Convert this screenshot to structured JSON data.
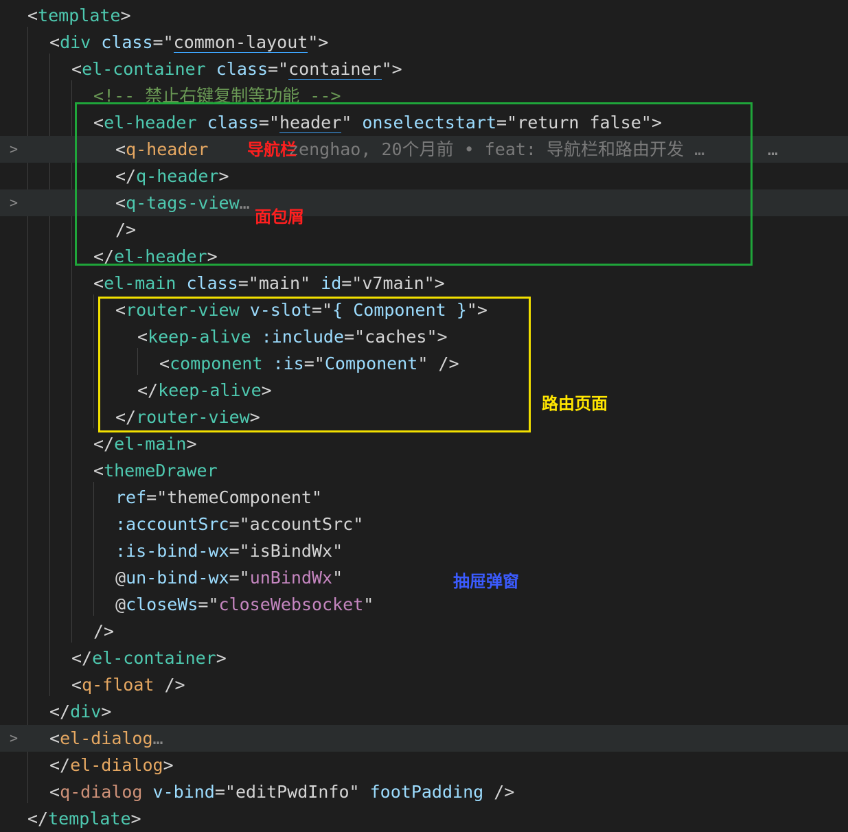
{
  "colors": {
    "background": "#1e1e1e",
    "highlight_line": "#2a2d2e",
    "tag": "#4ec9b0",
    "attribute": "#9cdcfe",
    "string": "#d4d4d4",
    "comment": "#6a9955",
    "box_header": "#1fa53a",
    "box_router": "#f2e000",
    "note_red": "#ff1f1f",
    "note_yellow": "#ffe600",
    "note_blue": "#3b5bff"
  },
  "icons": {
    "fold": "chevron-right-icon",
    "more": "ellipsis-icon"
  },
  "gutter": {
    "fold_glyph": ">"
  },
  "blame": {
    "text": "zenghao, 20个月前 • feat: 导航栏和路由开发 …",
    "more": "…"
  },
  "annotations": {
    "nav": "导航栏",
    "breadcrumb": "面包屑",
    "router_page": "路由页面",
    "drawer": "抽屉弹窗"
  },
  "lines": [
    [
      {
        "t": "<",
        "c": "punc"
      },
      {
        "t": "template",
        "c": "tag"
      },
      {
        "t": ">",
        "c": "punc"
      }
    ],
    [
      {
        "t": "<",
        "c": "punc"
      },
      {
        "t": "div",
        "c": "tag"
      },
      {
        "t": " class",
        "c": "attr"
      },
      {
        "t": "=\"",
        "c": "punc"
      },
      {
        "t": "common-layout",
        "c": "str-u"
      },
      {
        "t": "\">",
        "c": "punc"
      }
    ],
    [
      {
        "t": "<",
        "c": "punc"
      },
      {
        "t": "el-container",
        "c": "tag"
      },
      {
        "t": " class",
        "c": "attr"
      },
      {
        "t": "=\"",
        "c": "punc"
      },
      {
        "t": "container",
        "c": "str-u"
      },
      {
        "t": "\">",
        "c": "punc"
      }
    ],
    [
      {
        "t": "<!-- 禁止右键复制等功能 -->",
        "c": "comment"
      }
    ],
    [
      {
        "t": "<",
        "c": "punc"
      },
      {
        "t": "el-header",
        "c": "tag"
      },
      {
        "t": " class",
        "c": "attr"
      },
      {
        "t": "=\"",
        "c": "punc"
      },
      {
        "t": "header",
        "c": "str-u"
      },
      {
        "t": "\"",
        "c": "punc"
      },
      {
        "t": " onselectstart",
        "c": "attr"
      },
      {
        "t": "=\"return false\">",
        "c": "punc"
      }
    ],
    [
      {
        "t": "<",
        "c": "punc"
      },
      {
        "t": "q-header",
        "c": "tag3"
      }
    ],
    [
      {
        "t": "</",
        "c": "punc"
      },
      {
        "t": "q-header",
        "c": "tag"
      },
      {
        "t": ">",
        "c": "punc"
      }
    ],
    [
      {
        "t": "<",
        "c": "punc"
      },
      {
        "t": "q-tags-view",
        "c": "tag"
      },
      {
        "t": "…",
        "c": "fold"
      }
    ],
    [
      {
        "t": "/>",
        "c": "punc"
      }
    ],
    [
      {
        "t": "</",
        "c": "punc"
      },
      {
        "t": "el-header",
        "c": "tag"
      },
      {
        "t": ">",
        "c": "punc"
      }
    ],
    [
      {
        "t": "<",
        "c": "punc"
      },
      {
        "t": "el-main",
        "c": "tag"
      },
      {
        "t": " class",
        "c": "attr"
      },
      {
        "t": "=\"main\"",
        "c": "punc"
      },
      {
        "t": " id",
        "c": "attr"
      },
      {
        "t": "=\"v7main\">",
        "c": "punc"
      }
    ],
    [
      {
        "t": "<",
        "c": "punc"
      },
      {
        "t": "router-view",
        "c": "tag"
      },
      {
        "t": " v-slot",
        "c": "attr"
      },
      {
        "t": "=\"",
        "c": "punc"
      },
      {
        "t": "{ Component }",
        "c": "attr"
      },
      {
        "t": "\">",
        "c": "punc"
      }
    ],
    [
      {
        "t": "<",
        "c": "punc"
      },
      {
        "t": "keep-alive",
        "c": "tag"
      },
      {
        "t": " :include",
        "c": "attr"
      },
      {
        "t": "=\"caches\">",
        "c": "punc"
      }
    ],
    [
      {
        "t": "<",
        "c": "punc"
      },
      {
        "t": "component",
        "c": "tag"
      },
      {
        "t": " :is",
        "c": "attr"
      },
      {
        "t": "=\"",
        "c": "punc"
      },
      {
        "t": "Component",
        "c": "attr"
      },
      {
        "t": "\" />",
        "c": "punc"
      }
    ],
    [
      {
        "t": "</",
        "c": "punc"
      },
      {
        "t": "keep-alive",
        "c": "tag"
      },
      {
        "t": ">",
        "c": "punc"
      }
    ],
    [
      {
        "t": "</",
        "c": "punc"
      },
      {
        "t": "router-view",
        "c": "tag"
      },
      {
        "t": ">",
        "c": "punc"
      }
    ],
    [
      {
        "t": "</",
        "c": "punc"
      },
      {
        "t": "el-main",
        "c": "tag"
      },
      {
        "t": ">",
        "c": "punc"
      }
    ],
    [
      {
        "t": "<",
        "c": "punc"
      },
      {
        "t": "themeDrawer",
        "c": "tag"
      }
    ],
    [
      {
        "t": "ref",
        "c": "attr"
      },
      {
        "t": "=\"themeComponent\"",
        "c": "punc"
      }
    ],
    [
      {
        "t": ":accountSrc",
        "c": "attr"
      },
      {
        "t": "=\"accountSrc\"",
        "c": "punc"
      }
    ],
    [
      {
        "t": ":is-bind-wx",
        "c": "attr"
      },
      {
        "t": "=\"isBindWx\"",
        "c": "punc"
      }
    ],
    [
      {
        "t": "@",
        "c": "punc"
      },
      {
        "t": "un-bind-wx",
        "c": "attr"
      },
      {
        "t": "=\"",
        "c": "punc"
      },
      {
        "t": "unBindWx",
        "c": "evt"
      },
      {
        "t": "\"",
        "c": "punc"
      }
    ],
    [
      {
        "t": "@",
        "c": "punc"
      },
      {
        "t": "closeWs",
        "c": "attr"
      },
      {
        "t": "=\"",
        "c": "punc"
      },
      {
        "t": "closeWebsocket",
        "c": "evt"
      },
      {
        "t": "\"",
        "c": "punc"
      }
    ],
    [
      {
        "t": "/>",
        "c": "punc"
      }
    ],
    [
      {
        "t": "</",
        "c": "punc"
      },
      {
        "t": "el-container",
        "c": "tag"
      },
      {
        "t": ">",
        "c": "punc"
      }
    ],
    [
      {
        "t": "<",
        "c": "punc"
      },
      {
        "t": "q-float",
        "c": "tag3"
      },
      {
        "t": " />",
        "c": "punc"
      }
    ],
    [
      {
        "t": "</",
        "c": "punc"
      },
      {
        "t": "div",
        "c": "tag"
      },
      {
        "t": ">",
        "c": "punc"
      }
    ],
    [
      {
        "t": "<",
        "c": "punc"
      },
      {
        "t": "el-dialog",
        "c": "tag3"
      },
      {
        "t": "…",
        "c": "fold"
      }
    ],
    [
      {
        "t": "</",
        "c": "punc"
      },
      {
        "t": "el-dialog",
        "c": "tag3"
      },
      {
        "t": ">",
        "c": "punc"
      }
    ],
    [
      {
        "t": "<",
        "c": "punc"
      },
      {
        "t": "q-dialog",
        "c": "tag2"
      },
      {
        "t": " v-bind",
        "c": "attr"
      },
      {
        "t": "=\"editPwdInfo\"",
        "c": "punc"
      },
      {
        "t": " footPadding",
        "c": "attr"
      },
      {
        "t": " />",
        "c": "punc"
      }
    ],
    [
      {
        "t": "</",
        "c": "punc"
      },
      {
        "t": "template",
        "c": "tag"
      },
      {
        "t": ">",
        "c": "punc"
      }
    ]
  ]
}
